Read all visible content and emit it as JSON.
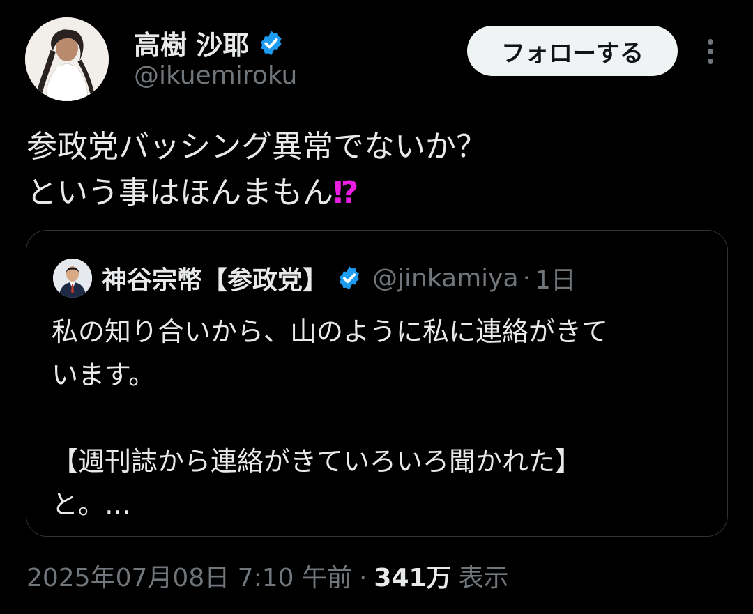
{
  "author": {
    "name": "高樹 沙耶",
    "handle": "@ikuemiroku"
  },
  "actions": {
    "follow_label": "フォローする"
  },
  "tweet": {
    "lines": [
      "参政党バッシング異常でないか？",
      "という事はほんまもん"
    ],
    "emoji": "⁉"
  },
  "quote": {
    "name": "神谷宗幣【参政党】",
    "handle": "@jinkamiya",
    "separator": "·",
    "time": "1日",
    "lines": [
      "私の知り合いから、山のように私に連絡がきて",
      "います。",
      "",
      "【週刊誌から連絡がきていろいろ聞かれた】",
      "と。…"
    ]
  },
  "meta": {
    "datetime": "2025年07月08日 7:10 午前",
    "separator": "·",
    "view_count": "341万",
    "view_label": "表示"
  },
  "colors": {
    "background": "#000000",
    "text": "#e7e9ea",
    "secondary": "#71767b",
    "verified": "#1d9bf0",
    "emoji": "#e91ee0",
    "follow_bg": "#eff3f4"
  }
}
